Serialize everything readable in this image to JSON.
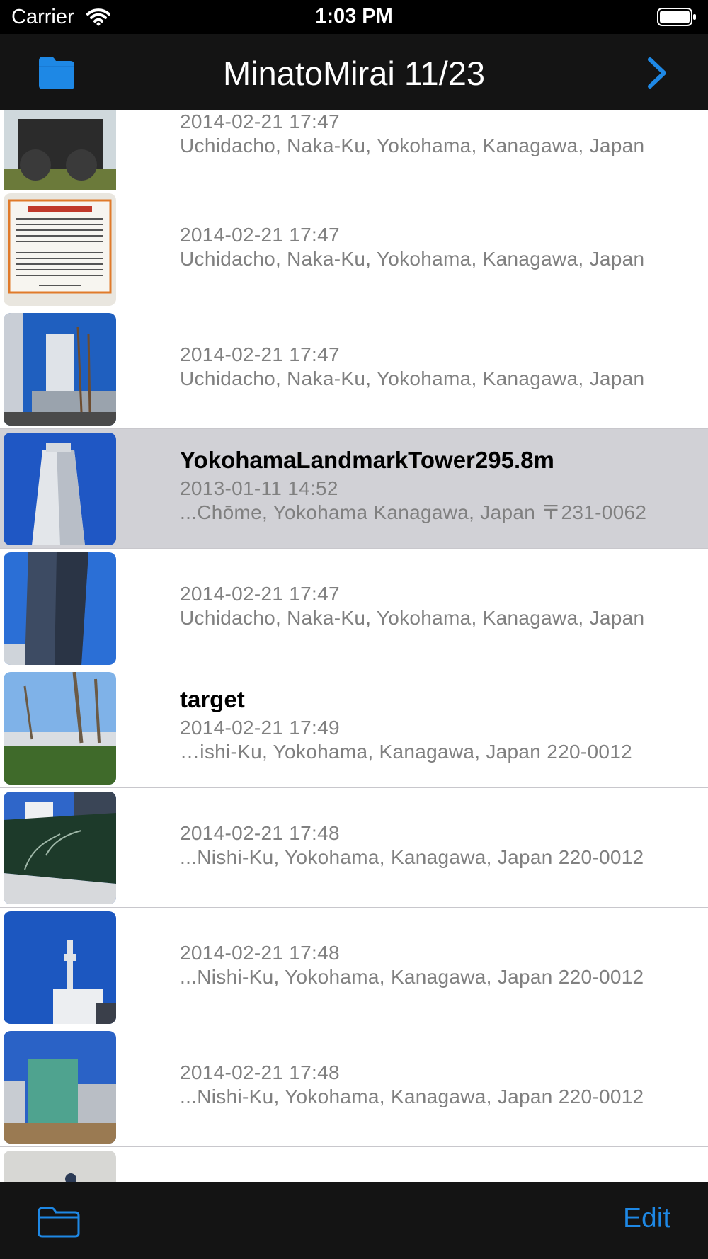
{
  "status_bar": {
    "carrier": "Carrier",
    "time": "1:03 PM"
  },
  "nav": {
    "title": "MinatoMirai 11/23",
    "accent_color": "#1e88e5",
    "left_icon": "folder-filled-icon",
    "right_icon": "chevron-right-icon"
  },
  "rows": [
    {
      "title": "",
      "date": "2014-02-21 17:47",
      "address": "Uchidacho, Naka-Ku, Yokohama, Kanagawa, Japan",
      "selected": false,
      "thumb": "steam-locomotive-photo"
    },
    {
      "title": "",
      "date": "2014-02-21 17:47",
      "address": "Uchidacho, Naka-Ku, Yokohama, Kanagawa, Japan",
      "selected": false,
      "thumb": "information-sign-photo"
    },
    {
      "title": "",
      "date": "2014-02-21 17:47",
      "address": "Uchidacho, Naka-Ku, Yokohama, Kanagawa, Japan",
      "selected": false,
      "thumb": "tower-and-sailing-ship-photo"
    },
    {
      "title": "YokohamaLandmarkTower295.8m",
      "date": "2013-01-11 14:52",
      "address": "...Chōme, Yokohama Kanagawa, Japan 〒231-0062",
      "selected": true,
      "thumb": "landmark-tower-photo"
    },
    {
      "title": "",
      "date": "2014-02-21 17:47",
      "address": "Uchidacho, Naka-Ku, Yokohama, Kanagawa, Japan",
      "selected": false,
      "thumb": "office-tower-photo"
    },
    {
      "title": "target",
      "date": "2014-02-21 17:49",
      "address": "…ishi-Ku, Yokohama, Kanagawa, Japan 220-0012",
      "selected": false,
      "thumb": "street-trees-photo"
    },
    {
      "title": "",
      "date": "2014-02-21 17:48",
      "address": "...Nishi-Ku, Yokohama, Kanagawa, Japan 220-0012",
      "selected": false,
      "thumb": "tree-mural-wall-photo"
    },
    {
      "title": "",
      "date": "2014-02-21 17:48",
      "address": "...Nishi-Ku, Yokohama, Kanagawa, Japan 220-0012",
      "selected": false,
      "thumb": "radio-mast-photo"
    },
    {
      "title": "",
      "date": "2014-02-21 17:48",
      "address": "...Nishi-Ku, Yokohama, Kanagawa, Japan 220-0012",
      "selected": false,
      "thumb": "glass-building-photo"
    },
    {
      "title": "",
      "date": "",
      "address": "",
      "selected": false,
      "thumb": "partial-photo"
    }
  ],
  "toolbar": {
    "left_icon": "folder-outline-icon",
    "edit_label": "Edit"
  }
}
